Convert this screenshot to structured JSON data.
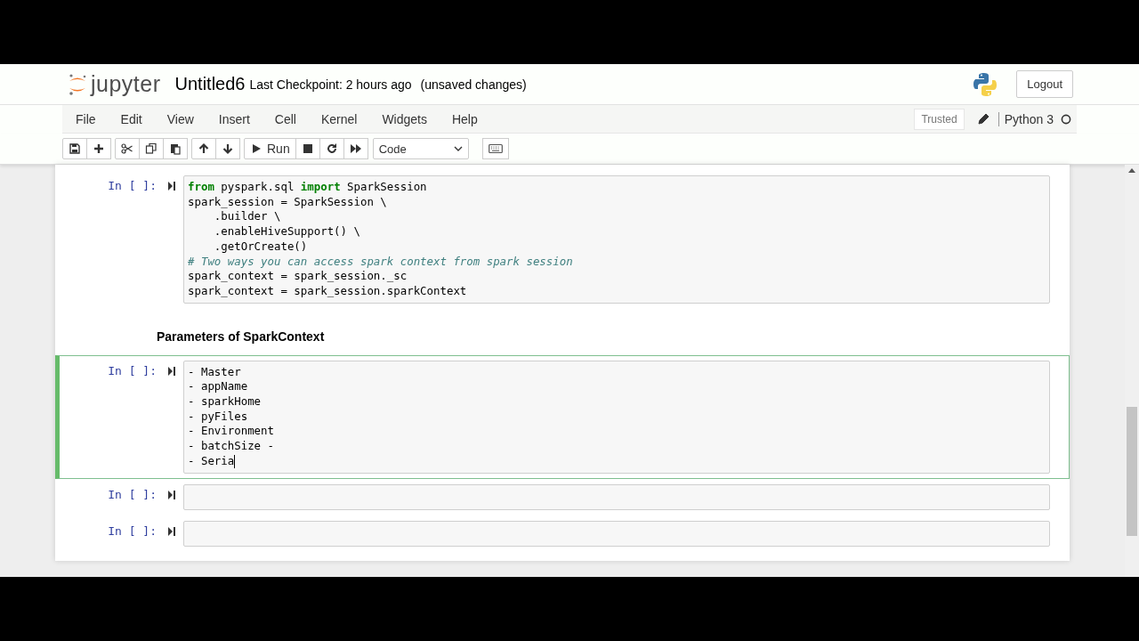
{
  "header": {
    "logo_text": "jupyter",
    "notebook_name": "Untitled6",
    "checkpoint": "Last Checkpoint: 2 hours ago",
    "autosave_status": "(unsaved changes)",
    "logout": "Logout"
  },
  "menubar": {
    "items": [
      "File",
      "Edit",
      "View",
      "Insert",
      "Cell",
      "Kernel",
      "Widgets",
      "Help"
    ],
    "trusted": "Trusted",
    "kernel_name": "Python 3"
  },
  "toolbar": {
    "run_label": "Run",
    "cell_type": "Code"
  },
  "cells": [
    {
      "kind": "code",
      "prompt": "In [ ]:",
      "selected": false,
      "lines": [
        {
          "kind": "code",
          "text": "**from** pyspark.sql **import** SparkSession"
        },
        {
          "kind": "code",
          "text": "spark_session = SparkSession \\"
        },
        {
          "kind": "code",
          "text": "    .builder \\"
        },
        {
          "kind": "code",
          "text": "    .enableHiveSupport() \\"
        },
        {
          "kind": "code",
          "text": "    .getOrCreate()"
        },
        {
          "kind": "comment",
          "text": "# Two ways you can access spark context from spark session"
        },
        {
          "kind": "code",
          "text": "spark_context = spark_session._sc"
        },
        {
          "kind": "code",
          "text": "spark_context = spark_session.sparkContext"
        }
      ]
    },
    {
      "kind": "markdown",
      "text": "Parameters of SparkContext",
      "selected": false
    },
    {
      "kind": "code",
      "prompt": "In [ ]:",
      "selected": true,
      "lines": [
        {
          "kind": "code",
          "text": "- Master"
        },
        {
          "kind": "code",
          "text": "- appName"
        },
        {
          "kind": "code",
          "text": "- sparkHome"
        },
        {
          "kind": "code",
          "text": "- pyFiles"
        },
        {
          "kind": "code",
          "text": "- Environment"
        },
        {
          "kind": "code",
          "text": "- batchSize -"
        },
        {
          "kind": "code",
          "text": "- Seria"
        }
      ]
    },
    {
      "kind": "code",
      "prompt": "In [ ]:",
      "selected": false
    },
    {
      "kind": "code",
      "prompt": "In [ ]:",
      "selected": false
    }
  ]
}
